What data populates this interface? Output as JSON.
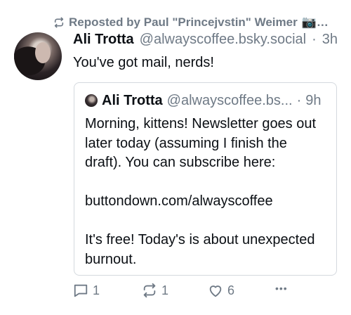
{
  "repost": {
    "label": "Reposted by Paul \"Princejvstin\" Weimer",
    "ellipsis": "📷…"
  },
  "post": {
    "author_name": "Ali Trotta",
    "author_handle": "@alwayscoffee.bsky.social",
    "separator": "·",
    "time": "3h",
    "text": "You've got mail, nerds!"
  },
  "quote": {
    "author_name": "Ali Trotta",
    "author_handle": "@alwayscoffee.bs...",
    "separator": "·",
    "time": "9h",
    "paragraphs": [
      "Morning, kittens! Newsletter goes out later today (assuming I finish the draft). You can subscribe here:",
      "buttondown.com/alwayscoffee",
      "It's free! Today's is about unexpected burnout."
    ]
  },
  "actions": {
    "reply_count": "1",
    "repost_count": "1",
    "like_count": "6",
    "more_label": "•••"
  },
  "icons": {
    "repost_indicator": "repost-icon",
    "reply": "reply-icon",
    "repost": "repost-icon",
    "like": "heart-icon",
    "more": "more-icon"
  },
  "colors": {
    "muted": "#6f7a86",
    "text": "#0b0f14",
    "border": "#d4d9de"
  }
}
